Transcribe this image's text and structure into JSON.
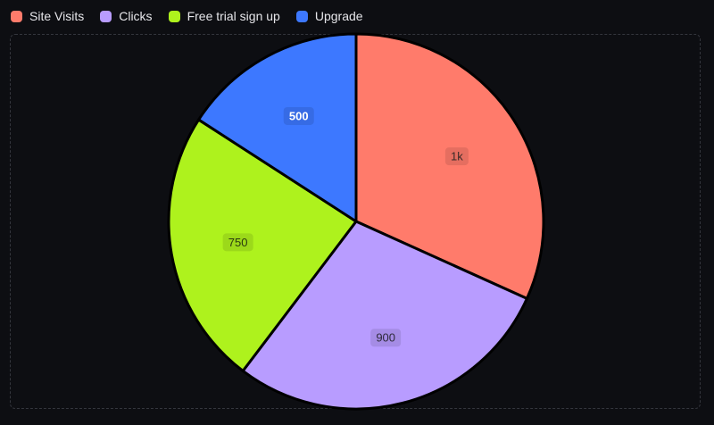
{
  "chart_data": {
    "type": "pie",
    "categories": [
      "Site Visits",
      "Clicks",
      "Free trial sign up",
      "Upgrade"
    ],
    "values": [
      1000,
      900,
      750,
      500
    ],
    "data_labels": [
      "1k",
      "900",
      "750",
      "500"
    ],
    "colors": [
      "#ff7b6b",
      "#b89cff",
      "#aef21d",
      "#3d78ff"
    ],
    "label_colors": [
      "#3a2a28",
      "#2e2a3a",
      "#2a3a10",
      "#ffffff"
    ],
    "legend_position": "top-left"
  }
}
